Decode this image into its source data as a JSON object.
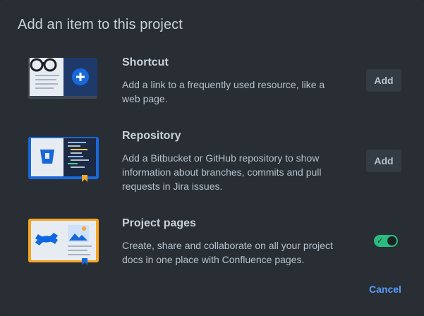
{
  "dialog": {
    "title": "Add an item to this project",
    "cancel_label": "Cancel"
  },
  "items": [
    {
      "illustration_icon": "shortcut-book-glasses-icon",
      "title": "Shortcut",
      "description": "Add a link to a frequently used resource, like a web page.",
      "action_label": "Add"
    },
    {
      "illustration_icon": "bitbucket-repository-book-icon",
      "title": "Repository",
      "description": "Add a Bitbucket or GitHub repository to show information about branches, commits and pull requests in Jira issues.",
      "action_label": "Add"
    },
    {
      "illustration_icon": "confluence-pages-book-icon",
      "title": "Project pages",
      "description": "Create, share and collaborate on all your project docs in one place with Confluence pages.",
      "toggle_on": true
    }
  ],
  "colors": {
    "background": "#282e33",
    "text_primary": "#c7d1db",
    "text_secondary": "#b6c2cf",
    "link": "#579dff",
    "toggle_on": "#2abb7f"
  }
}
